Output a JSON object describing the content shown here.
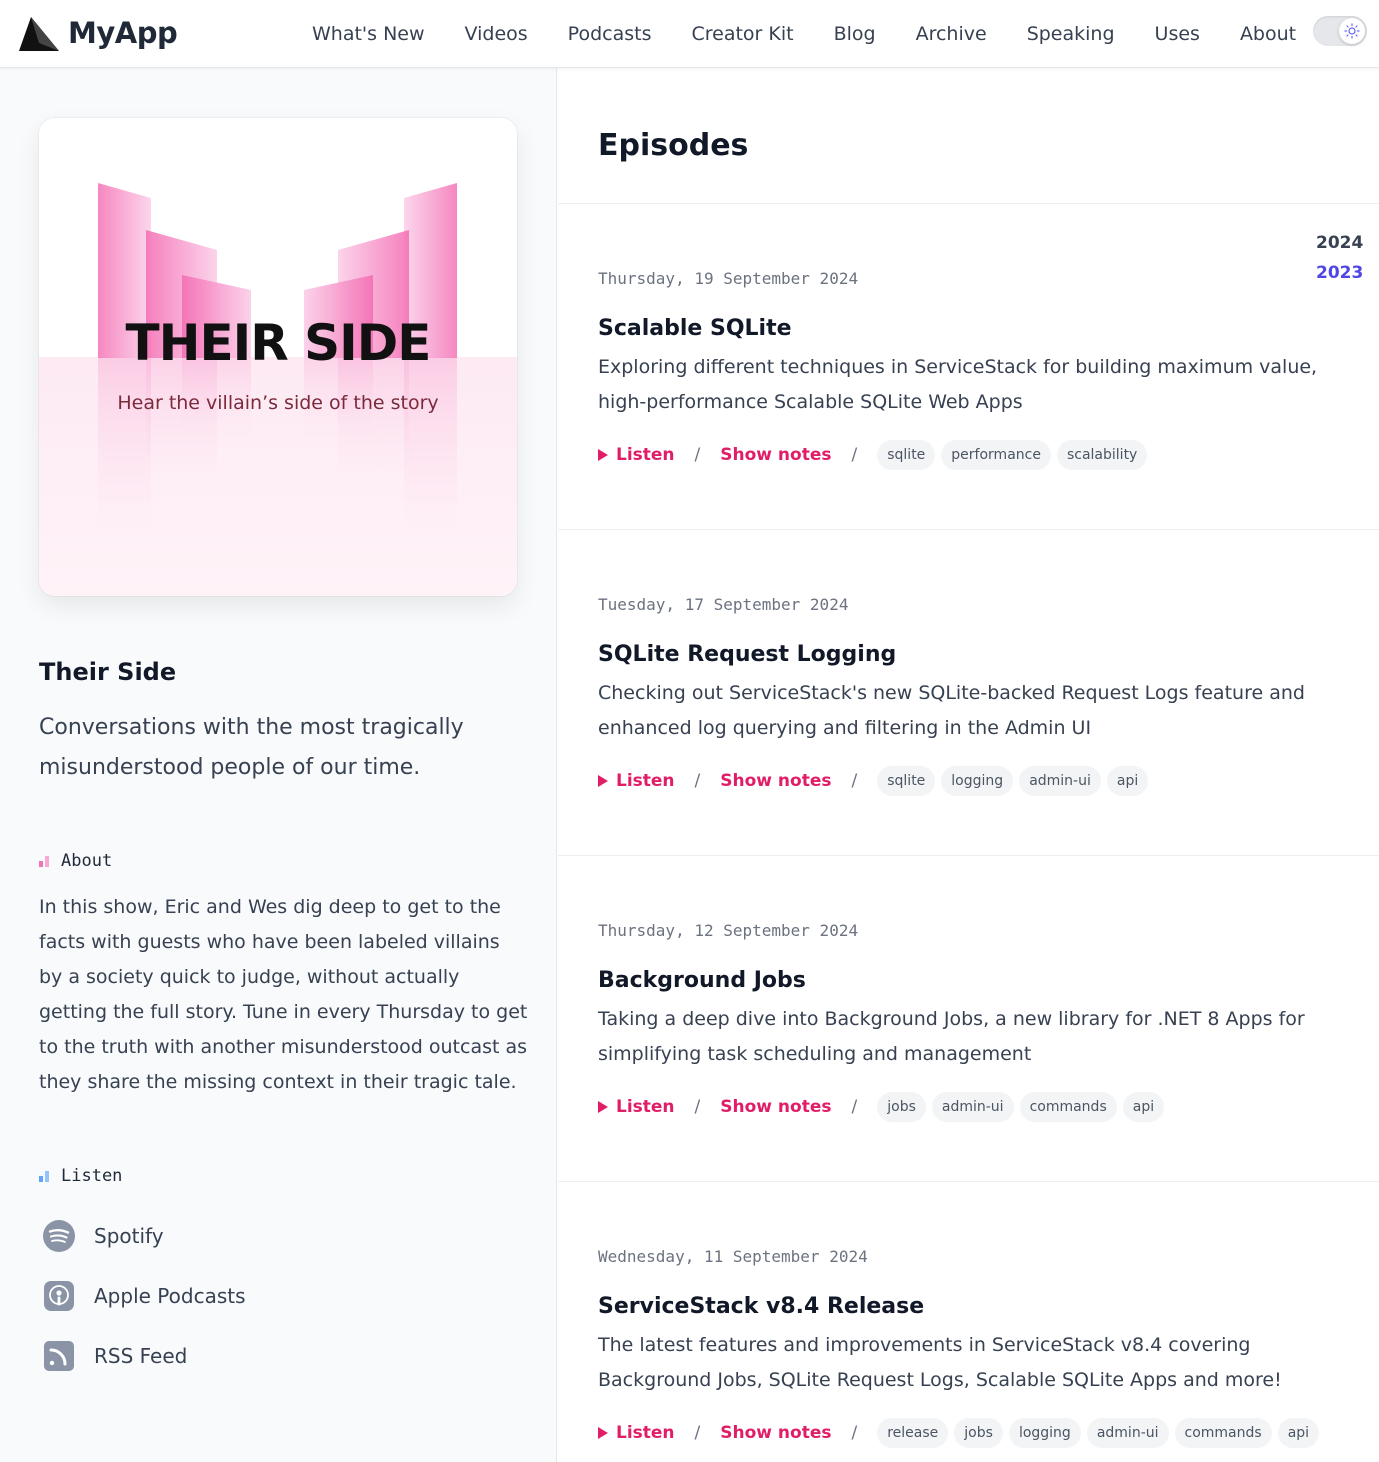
{
  "header": {
    "logo_text": "MyApp",
    "nav": [
      "What's New",
      "Videos",
      "Podcasts",
      "Creator Kit",
      "Blog",
      "Archive",
      "Speaking",
      "Uses",
      "About"
    ]
  },
  "sidebar": {
    "cover_title": "THEIR SIDE",
    "cover_subtitle": "Hear the villain’s side of the story",
    "show_title": "Their Side",
    "show_description": "Conversations with the most tragically misunderstood people of our time.",
    "about_heading": "About",
    "about_text": "In this show, Eric and Wes dig deep to get to the facts with guests who have been labeled villains by a society quick to judge, without actually getting the full story. Tune in every Thursday to get to the truth with another misunderstood outcast as they share the missing context in their tragic tale.",
    "listen_heading": "Listen",
    "platforms": [
      {
        "label": "Spotify",
        "icon": "spotify-icon"
      },
      {
        "label": "Apple Podcasts",
        "icon": "apple-podcasts-icon"
      },
      {
        "label": "RSS Feed",
        "icon": "rss-icon"
      }
    ]
  },
  "main": {
    "heading": "Episodes",
    "years": [
      "2024",
      "2023"
    ],
    "listen_label": "Listen",
    "shownotes_label": "Show notes",
    "separator": "/",
    "episodes": [
      {
        "date": "Thursday, 19 September 2024",
        "title": "Scalable SQLite",
        "description": "Exploring different techniques in ServiceStack for building maximum value, high-performance Scalable SQLite Web Apps",
        "tags": [
          "sqlite",
          "performance",
          "scalability"
        ]
      },
      {
        "date": "Tuesday, 17 September 2024",
        "title": "SQLite Request Logging",
        "description": "Checking out ServiceStack's new SQLite-backed Request Logs feature and enhanced log querying and filtering in the Admin UI",
        "tags": [
          "sqlite",
          "logging",
          "admin-ui",
          "api"
        ]
      },
      {
        "date": "Thursday, 12 September 2024",
        "title": "Background Jobs",
        "description": "Taking a deep dive into Background Jobs, a new library for .NET 8 Apps for simplifying task scheduling and management",
        "tags": [
          "jobs",
          "admin-ui",
          "commands",
          "api"
        ]
      },
      {
        "date": "Wednesday, 11 September 2024",
        "title": "ServiceStack v8.4 Release",
        "description": "The latest features and improvements in ServiceStack v8.4 covering Background Jobs, SQLite Request Logs, Scalable SQLite Apps and more!",
        "tags": [
          "release",
          "jobs",
          "logging",
          "admin-ui",
          "commands",
          "api"
        ]
      }
    ]
  },
  "colors": {
    "accent": "#e11d68",
    "year_active": "#374151",
    "year_link": "#4f46e5"
  }
}
